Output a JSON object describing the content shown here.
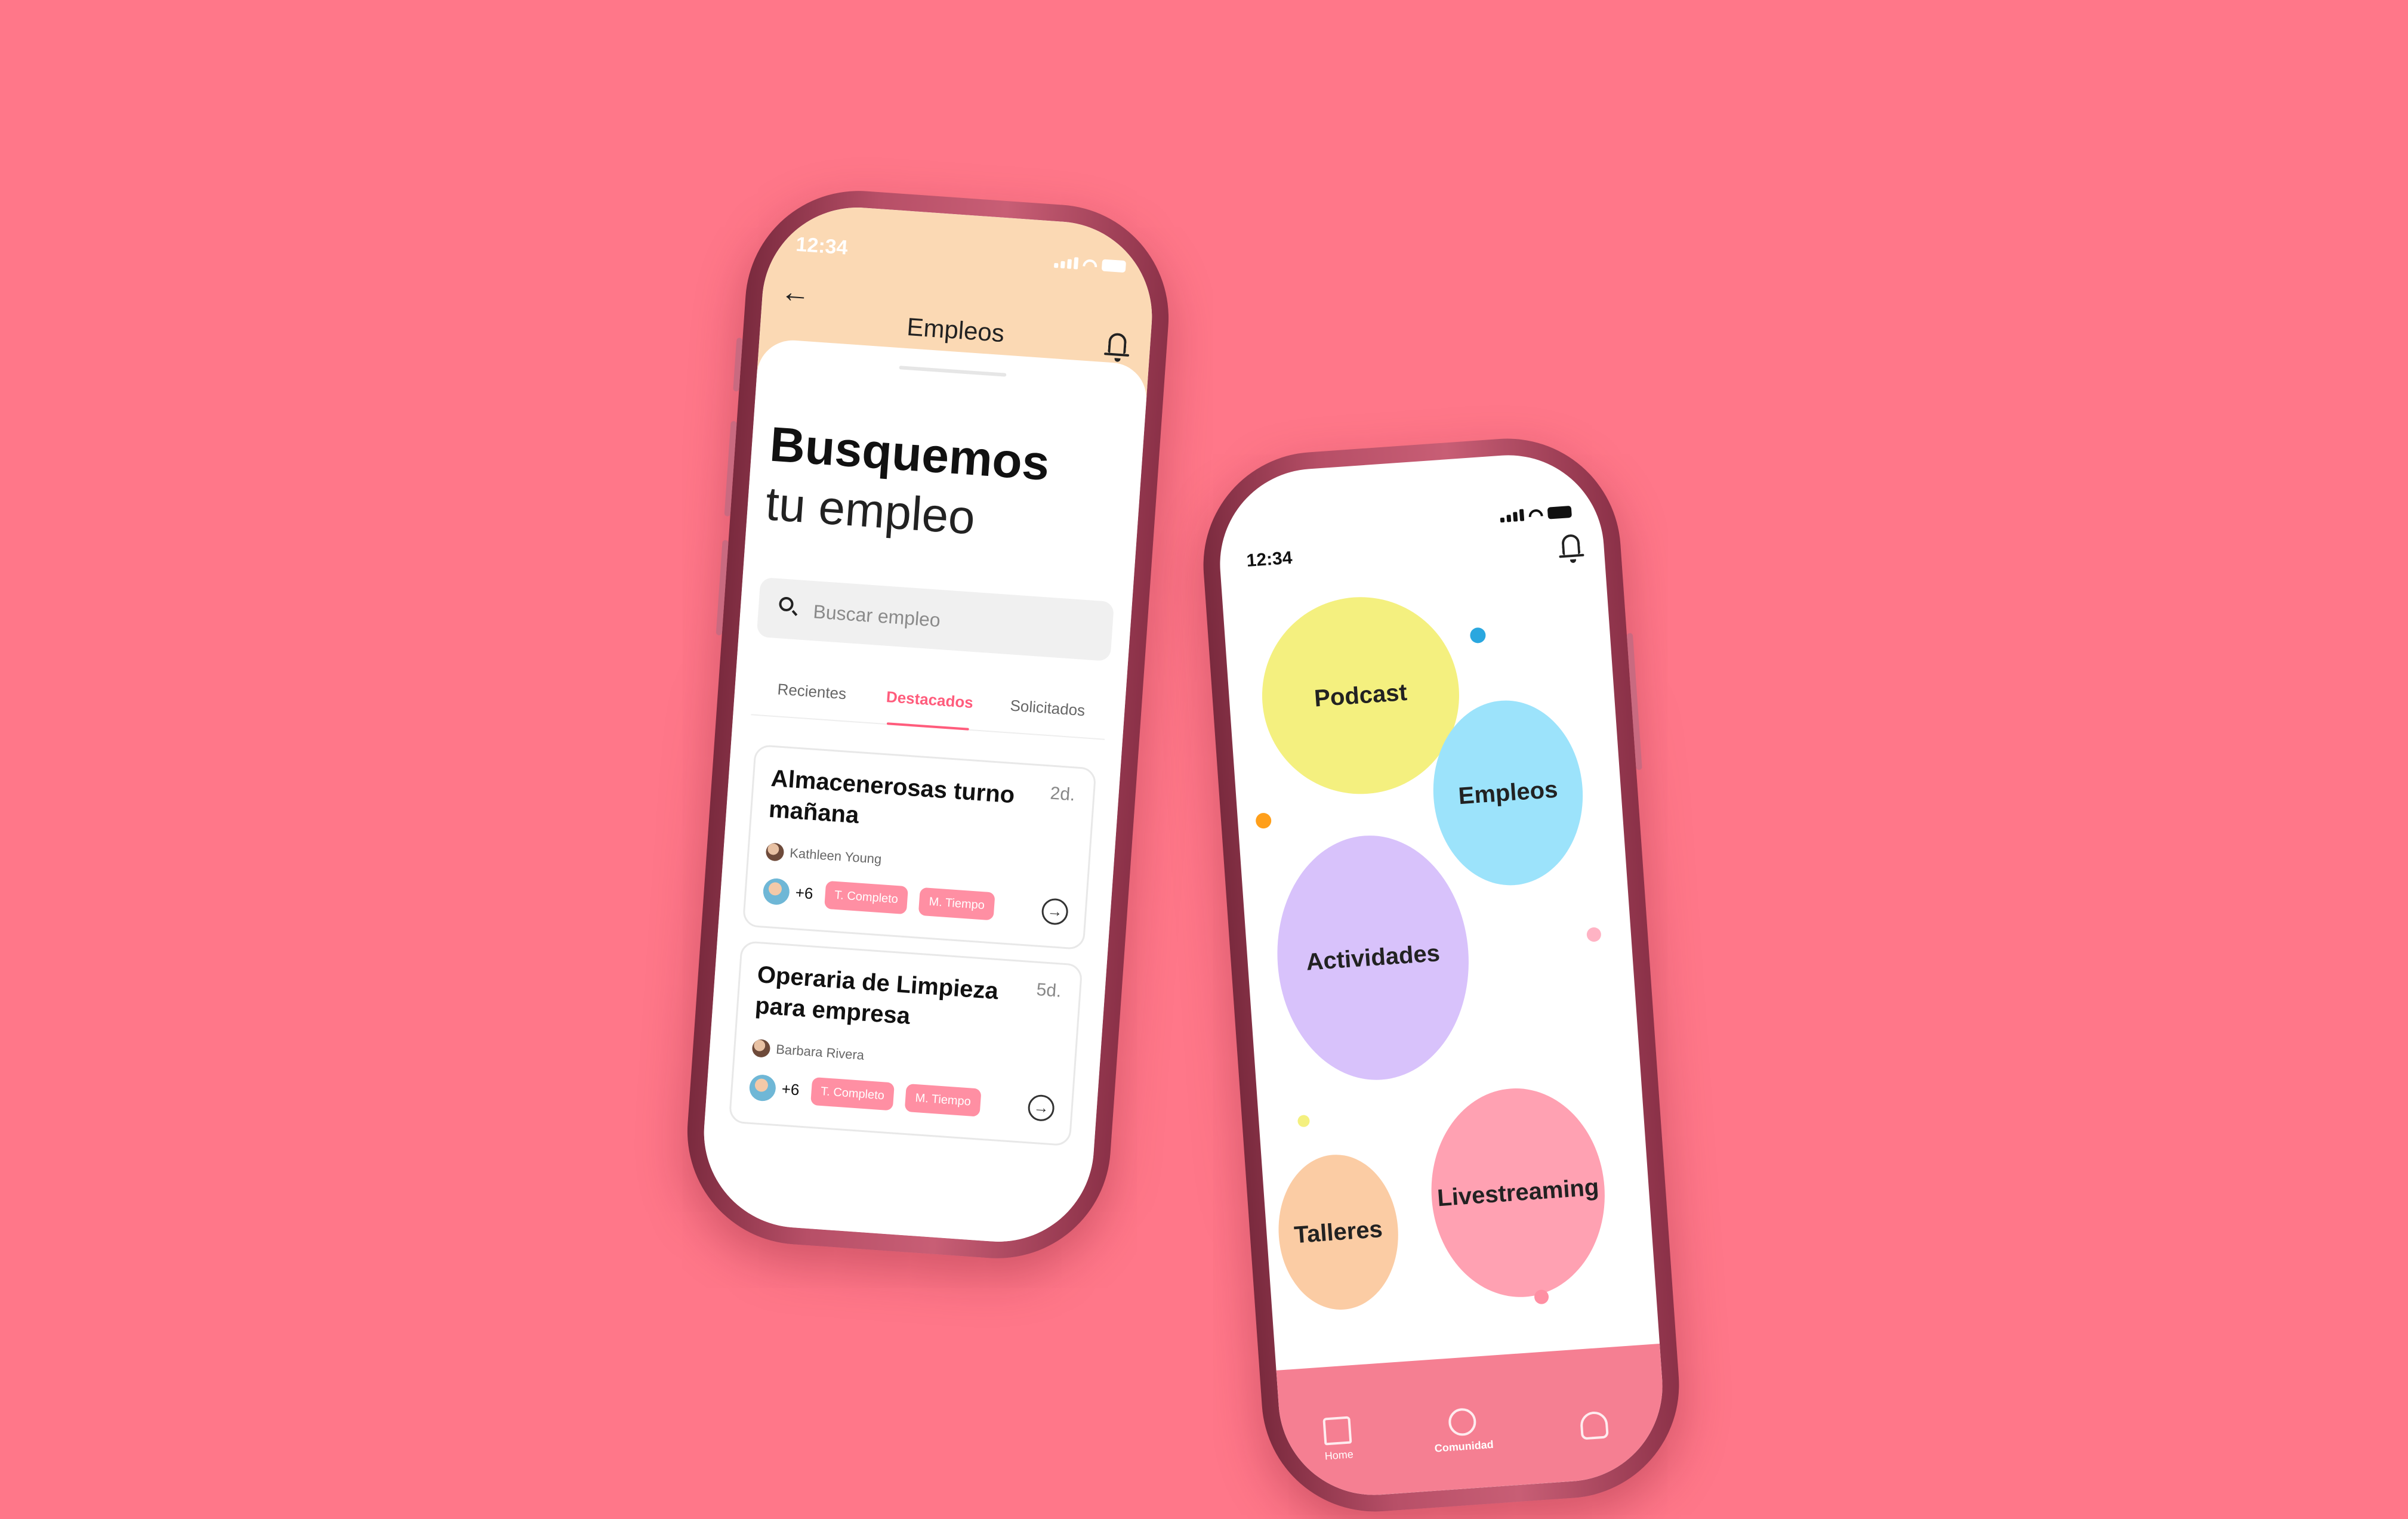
{
  "phone_jobs": {
    "status_time": "12:34",
    "header_title": "Empleos",
    "hero_bold": "Busquemos",
    "hero_light": "tu empleo",
    "search": {
      "placeholder": "Buscar empleo"
    },
    "tabs": [
      {
        "label": "Recientes",
        "active": false
      },
      {
        "label": "Destacados",
        "active": true
      },
      {
        "label": "Solicitados",
        "active": false
      }
    ],
    "jobs": [
      {
        "title": "Almacenerosas turno mañana",
        "age": "2d.",
        "author": "Kathleen Young",
        "extra_count": "+6",
        "badges": [
          "T. Completo",
          "M. Tiempo"
        ]
      },
      {
        "title": "Operaria de Limpieza para empresa",
        "age": "5d.",
        "author": "Barbara Rivera",
        "extra_count": "+6",
        "badges": [
          "T. Completo",
          "M. Tiempo"
        ]
      }
    ]
  },
  "phone_community": {
    "status_time": "12:34",
    "bubbles": [
      {
        "label": "Podcast",
        "color": "#f4f07f"
      },
      {
        "label": "Empleos",
        "color": "#9ce3fb"
      },
      {
        "label": "Actividades",
        "color": "#d8c2fb"
      },
      {
        "label": "Livestreaming",
        "color": "#ffa1b2"
      },
      {
        "label": "Talleres",
        "color": "#fbcca4"
      }
    ],
    "nav": [
      {
        "label": "Home",
        "icon": "home-icon",
        "active": false
      },
      {
        "label": "Comunidad",
        "icon": "community-icon",
        "active": true
      },
      {
        "label": "",
        "icon": "profile-icon",
        "active": false
      }
    ]
  },
  "colors": {
    "background": "#ff7789",
    "accent": "#ff5c7c",
    "badge": "#ff8fa3",
    "header_peach": "#fbd9b4"
  }
}
